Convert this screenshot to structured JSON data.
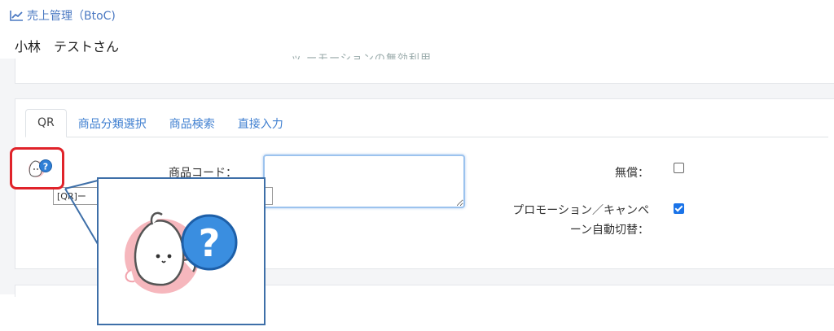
{
  "header": {
    "title": "売上管理（BtoC)",
    "title_icon": "line-chart-icon",
    "user_name": "小林　テストさん"
  },
  "top_panel": {
    "clipped_text": "ッ ーモーションの無効利用"
  },
  "tabs": [
    {
      "label": "QR",
      "active": true
    },
    {
      "label": "商品分類選択",
      "active": false
    },
    {
      "label": "商品検索",
      "active": false
    },
    {
      "label": "直接入力",
      "active": false
    }
  ],
  "form": {
    "product_code_label": "商品コード：",
    "product_code_value": "",
    "qr_input_value": "[QR]ー ",
    "free_label": "無償：",
    "free_checked": false,
    "promo_label_line1": "プロモーション／キャンペ",
    "promo_label_line2": "ーン自動切替：",
    "promo_checked": true
  },
  "help_icon": {
    "name": "help-mascot-icon",
    "symbol": "?"
  },
  "colors": {
    "accent": "#3f7fd0",
    "highlight": "#e0232a",
    "callout_border": "#3e6fa8",
    "help_badge": "#2f7fd6"
  }
}
